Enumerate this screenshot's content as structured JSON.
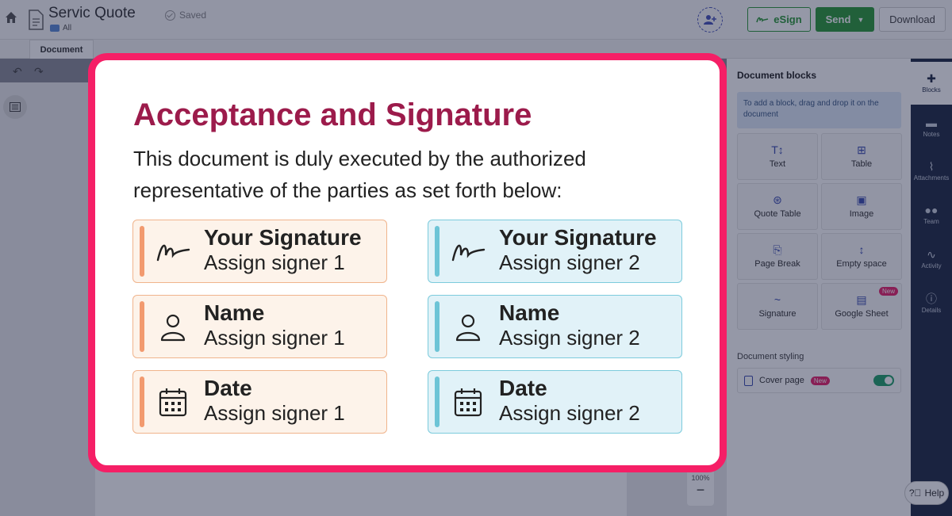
{
  "header": {
    "doc_title": "Servic Quote",
    "folder": "All",
    "saved_status": "Saved",
    "esign_label": "eSign",
    "send_label": "Send",
    "download_label": "Download"
  },
  "tabs": {
    "document": "Document"
  },
  "zoom": {
    "level": "100%",
    "minus": "−"
  },
  "panel": {
    "title": "Document blocks",
    "hint": "To add a block, drag and drop it on the document",
    "blocks": [
      {
        "label": "Text",
        "icon": "text-size-icon",
        "glyph": "T↕"
      },
      {
        "label": "Table",
        "icon": "table-icon",
        "glyph": "⊞"
      },
      {
        "label": "Quote Table",
        "icon": "quote-table-icon",
        "glyph": "⊛"
      },
      {
        "label": "Image",
        "icon": "image-icon",
        "glyph": "▣"
      },
      {
        "label": "Page Break",
        "icon": "page-break-icon",
        "glyph": "⎘"
      },
      {
        "label": "Empty space",
        "icon": "empty-space-icon",
        "glyph": "↕"
      },
      {
        "label": "Signature",
        "icon": "signature-icon",
        "glyph": "~"
      },
      {
        "label": "Google Sheet",
        "icon": "google-sheet-icon",
        "glyph": "▤",
        "badge": "New"
      }
    ],
    "styling_title": "Document styling",
    "cover_page_label": "Cover page",
    "cover_page_badge": "New"
  },
  "rail": [
    {
      "label": "Blocks",
      "icon": "puzzle-icon",
      "glyph": "✚"
    },
    {
      "label": "Notes",
      "icon": "notes-icon",
      "glyph": "▬"
    },
    {
      "label": "Attachments",
      "icon": "paperclip-icon",
      "glyph": "⌇"
    },
    {
      "label": "Team",
      "icon": "team-icon",
      "glyph": "●●"
    },
    {
      "label": "Activity",
      "icon": "activity-icon",
      "glyph": "∿"
    },
    {
      "label": "Details",
      "icon": "info-icon",
      "glyph": "ⓘ"
    }
  ],
  "help_label": "Help",
  "modal": {
    "title": "Acceptance and Signature",
    "description": "This document is duly executed by the authorized representative of the parties as set forth below:",
    "signer1": [
      {
        "title": "Your Signature",
        "sub": "Assign signer 1",
        "icon": "signature-icon"
      },
      {
        "title": "Name",
        "sub": "Assign signer 1",
        "icon": "person-icon"
      },
      {
        "title": "Date",
        "sub": "Assign signer 1",
        "icon": "calendar-icon"
      }
    ],
    "signer2": [
      {
        "title": "Your Signature",
        "sub": "Assign signer 2",
        "icon": "signature-icon"
      },
      {
        "title": "Name",
        "sub": "Assign signer 2",
        "icon": "person-icon"
      },
      {
        "title": "Date",
        "sub": "Assign signer 2",
        "icon": "calendar-icon"
      }
    ]
  },
  "colors": {
    "modal_border": "#f51f66",
    "title": "#9c1b4b",
    "signer1_bg": "#fdf3ea",
    "signer1_accent": "#f29a6f",
    "signer2_bg": "#e1f2f8",
    "signer2_accent": "#6cc4d6",
    "primary_green": "#2c9a3a"
  }
}
